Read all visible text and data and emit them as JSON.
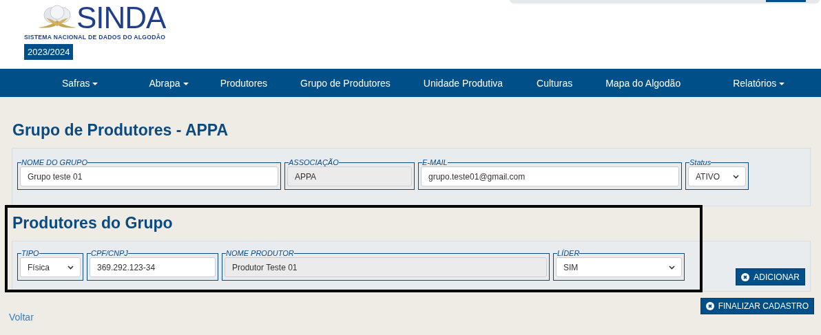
{
  "header": {
    "logo_name": "SINDA",
    "tagline": "SISTEMA NACIONAL DE DADOS DO ALGODÃO",
    "season": "2023/2024"
  },
  "nav": [
    {
      "label": "Safras",
      "dropdown": true
    },
    {
      "label": "Abrapa",
      "dropdown": true
    },
    {
      "label": "Produtores",
      "dropdown": false
    },
    {
      "label": "Grupo de Produtores",
      "dropdown": false
    },
    {
      "label": "Unidade Produtiva",
      "dropdown": false
    },
    {
      "label": "Culturas",
      "dropdown": false
    },
    {
      "label": "Mapa do Algodão",
      "dropdown": false
    },
    {
      "label": "Relatórios",
      "dropdown": true
    }
  ],
  "group": {
    "title": "Grupo de Produtores - APPA",
    "fields": [
      {
        "kind": "input",
        "legend": "NOME DO GRUPO",
        "value": "Grupo teste 01",
        "disabled": false
      },
      {
        "kind": "input",
        "legend": "ASSOCIAÇÃO",
        "value": "APPA",
        "disabled": true
      },
      {
        "kind": "input",
        "legend": "E-MAIL",
        "value": "grupo.teste01@gmail.com",
        "disabled": false
      },
      {
        "kind": "select",
        "legend": "Status",
        "value": "ATIVO",
        "disabled": false
      }
    ]
  },
  "producers": {
    "title": "Produtores do Grupo",
    "fields": [
      {
        "kind": "select",
        "legend": "TIPO",
        "value": "Física",
        "disabled": false
      },
      {
        "kind": "input",
        "legend": "CPF/CNPJ",
        "value": "369.292.123-34",
        "disabled": false
      },
      {
        "kind": "input",
        "legend": "NOME PRODUTOR",
        "value": "Produtor Teste 01",
        "disabled": true
      },
      {
        "kind": "select",
        "legend": "LÍDER",
        "value": "SIM",
        "disabled": false
      }
    ],
    "add_button": "ADICIONAR"
  },
  "back_link": "Voltar",
  "finish_button": "FINALIZAR CADASTRO"
}
